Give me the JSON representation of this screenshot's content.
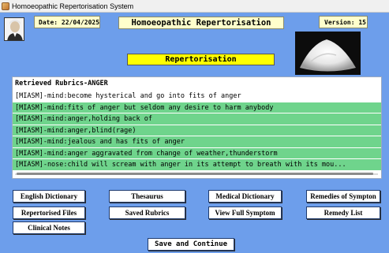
{
  "window": {
    "title": "Homoeopathic Repertorisation System"
  },
  "header": {
    "date": "Date: 22/04/2025",
    "app_title": "Homoeopathic Repertorisation",
    "version": "Version: 15"
  },
  "section": {
    "title": "Repertorisation"
  },
  "rubrics": {
    "header": "Retrieved Rubrics-ANGER",
    "items": [
      "[MIASM]-mind:become hysterical and go into fits of anger",
      "[MIASM]-mind:fits of anger but seldom any desire to harm anybody",
      "[MIASM]-mind:anger,holding back of",
      "[MIASM]-mind:anger,blind(rage)",
      "[MIASM]-mind:jealous and has fits of anger",
      "[MIASM]-mind:anger aggravated from change of weather,thunderstorm",
      "[MIASM]-nose:child will scream with anger in its attempt to breath with its mou..."
    ]
  },
  "buttons": {
    "english_dictionary": "English Dictionary",
    "thesaurus": "Thesaurus",
    "medical_dictionary": "Medical Dictionary",
    "remedies_of_symptom": "Remedies of Sympton",
    "repertorised_files": "Repertorised Files",
    "saved_rubrics": "Saved Rubrics",
    "view_full_symptom": "View Full Symptom",
    "remedy_list": "Remedy List",
    "clinical_notes": "Clinical Notes",
    "save_and_continue": "Save and Continue"
  },
  "colors": {
    "background": "#6d9eeb",
    "row_highlight": "#6fd48c",
    "title_yellow": "#ffff00",
    "label_cream": "#ffffcc"
  }
}
